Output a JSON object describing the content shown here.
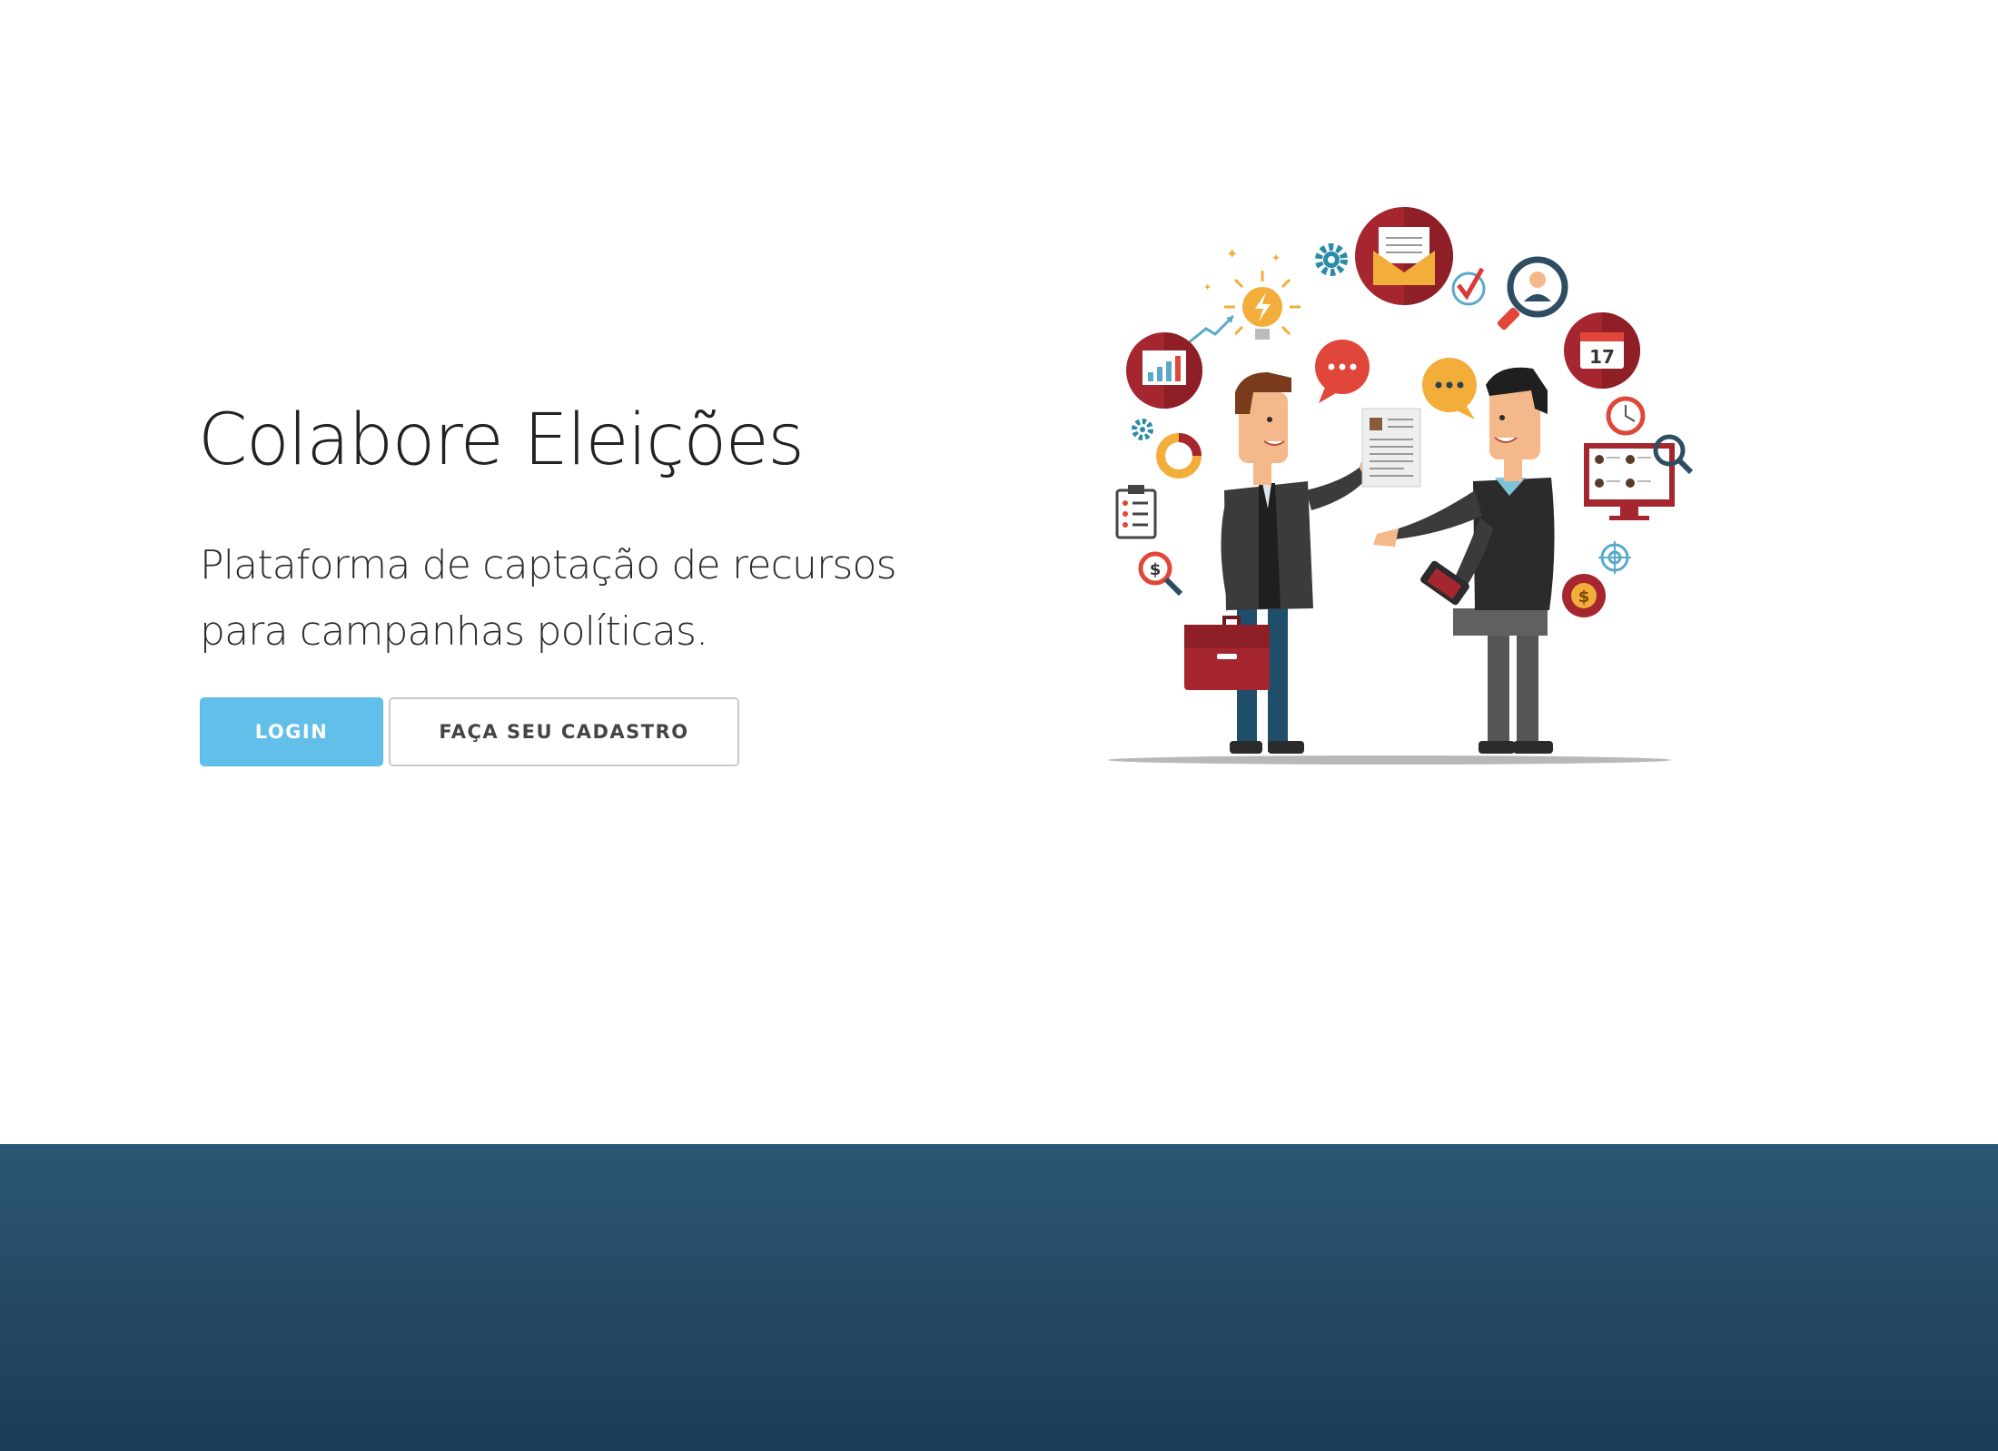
{
  "hero": {
    "title": "Colabore Eleições",
    "subtitle_line1": "Plataforma de captação de recursos",
    "subtitle_line2": "para campanhas políticas.",
    "login_label": "LOGIN",
    "register_label": "FAÇA SEU CADASTRO",
    "calendar_day": "17"
  },
  "colors": {
    "accent_button": "#62bfea",
    "footer_top": "#2b5674",
    "footer_bottom": "#1d3c56",
    "illustration_red": "#a5262f",
    "illustration_yellow": "#f2ad3b"
  },
  "icons": [
    "idea-bulb-icon",
    "email-icon",
    "gear-icon",
    "checkmark-icon",
    "user-search-icon",
    "bar-chart-icon",
    "speech-bubble-icon",
    "calendar-icon",
    "clock-icon",
    "donut-chart-icon",
    "clipboard-icon",
    "dollar-search-icon",
    "monitor-profiles-icon",
    "target-icon",
    "coin-icon",
    "resume-icon",
    "briefcase-icon",
    "phone-icon"
  ]
}
